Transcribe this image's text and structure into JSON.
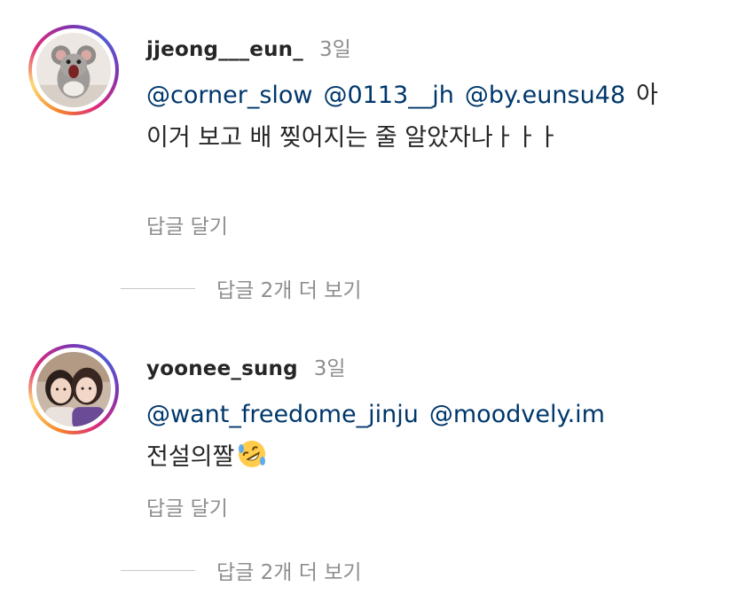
{
  "comments": [
    {
      "username": "jjeong___eun_",
      "time": "3일",
      "mentions": [
        "@corner_slow",
        "@0113__jh",
        "@by.eunsu48"
      ],
      "text_after_mentions": "아",
      "text_line2": "이거 보고 배 찢어지는 줄 알았자나ㅏㅏㅏ",
      "reply_label": "답글 달기",
      "more_replies_label": "답글 2개 더 보기"
    },
    {
      "username": "yoonee_sung",
      "time": "3일",
      "mentions": [
        "@want_freedome_jinju",
        "@moodvely.im"
      ],
      "text_line2": "전설의짤",
      "emoji": "rolling-on-floor-laughing-emoji",
      "reply_label": "답글 달기",
      "more_replies_label": "답글 2개 더 보기"
    }
  ],
  "colors": {
    "mention": "#00376b",
    "username": "#262626",
    "secondary": "#8e8e8e",
    "divider": "#c7c7c7"
  }
}
